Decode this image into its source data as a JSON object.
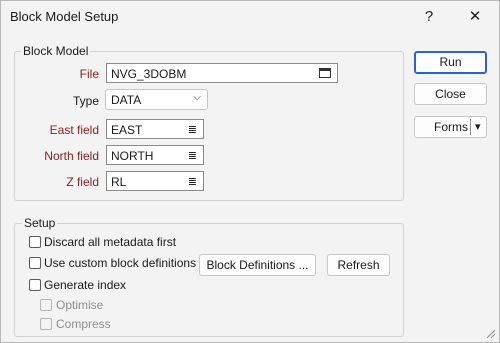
{
  "window": {
    "title": "Block Model Setup",
    "help_glyph": "?",
    "close_glyph": "✕"
  },
  "block_model": {
    "group_label": "Block Model",
    "file": {
      "label": "File",
      "value": "NVG_3DOBM"
    },
    "type": {
      "label": "Type",
      "value": "DATA"
    },
    "east": {
      "label": "East field",
      "value": "EAST"
    },
    "north": {
      "label": "North field",
      "value": "NORTH"
    },
    "z": {
      "label": "Z field",
      "value": "RL"
    }
  },
  "setup": {
    "group_label": "Setup",
    "discard": {
      "label": "Discard all metadata first",
      "checked": false
    },
    "custom": {
      "label": "Use custom block definitions",
      "checked": false
    },
    "generate": {
      "label": "Generate index",
      "checked": false
    },
    "optimise": {
      "label": "Optimise",
      "checked": false,
      "enabled": false
    },
    "compress": {
      "label": "Compress",
      "checked": false,
      "enabled": false
    },
    "block_defs_label": "Block Definitions ...",
    "refresh_label": "Refresh"
  },
  "actions": {
    "run_label": "Run",
    "close_label": "Close",
    "forms_label": "Forms",
    "forms_arrow": "▾"
  },
  "icons": {
    "list_glyph": "≣",
    "chevron_glyph": "⌵"
  },
  "colors": {
    "accent": "#2d62c8",
    "required_label": "#8b1c1c"
  }
}
